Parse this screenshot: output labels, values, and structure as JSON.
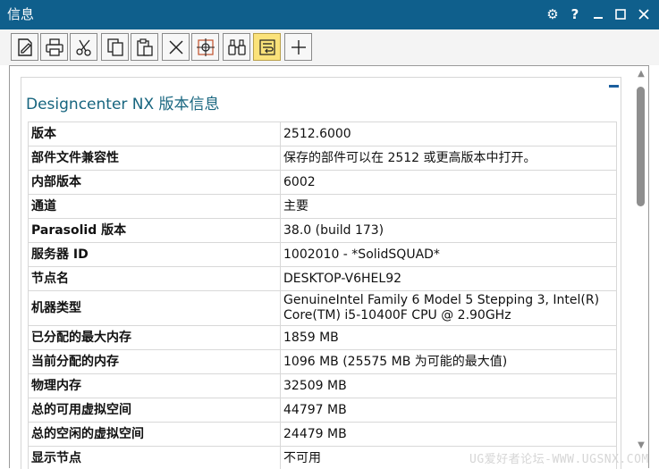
{
  "window": {
    "title": "信息",
    "controls": {
      "settings": "⚙",
      "help": "?",
      "minimize": "—",
      "maximize": "☐",
      "close": "✕"
    }
  },
  "toolbar": {
    "items": [
      {
        "name": "edit-file-icon",
        "active": false
      },
      {
        "name": "print-icon",
        "active": false
      },
      {
        "name": "cut-icon",
        "active": false
      },
      {
        "name": "copy-icon",
        "active": false
      },
      {
        "name": "paste-icon",
        "active": false
      },
      {
        "name": "delete-icon",
        "active": false
      },
      {
        "name": "target-icon",
        "active": false
      },
      {
        "name": "binoculars-icon",
        "active": false
      },
      {
        "name": "wrap-text-icon",
        "active": true
      },
      {
        "name": "plus-icon",
        "active": false
      }
    ]
  },
  "panel": {
    "title": "Designcenter NX 版本信息",
    "collapse": "−"
  },
  "rows": [
    {
      "key": "版本",
      "value": "2512.6000"
    },
    {
      "key": "部件文件兼容性",
      "value": "保存的部件可以在 2512 或更高版本中打开。"
    },
    {
      "key": "内部版本",
      "value": "6002"
    },
    {
      "key": "通道",
      "value": "主要"
    },
    {
      "key": "Parasolid 版本",
      "value": "38.0 (build 173)"
    },
    {
      "key": "服务器 ID",
      "value": "1002010 - *SolidSQUAD*"
    },
    {
      "key": "节点名",
      "value": "DESKTOP-V6HEL92"
    },
    {
      "key": "机器类型",
      "value": "GenuineIntel Family 6 Model 5 Stepping 3, Intel(R) Core(TM) i5-10400F CPU @ 2.90GHz"
    },
    {
      "key": "已分配的最大内存",
      "value": "1859 MB"
    },
    {
      "key": "当前分配的内存",
      "value": "1096 MB (25575 MB 为可能的最大值)"
    },
    {
      "key": "物理内存",
      "value": "32509 MB"
    },
    {
      "key": "总的可用虚拟空间",
      "value": "44797 MB"
    },
    {
      "key": "总的空闲的虚拟空间",
      "value": "24479 MB"
    },
    {
      "key": "显示节点",
      "value": "不可用"
    }
  ],
  "watermark": "UG爱好者论坛-WWW.UGSNX.COM"
}
